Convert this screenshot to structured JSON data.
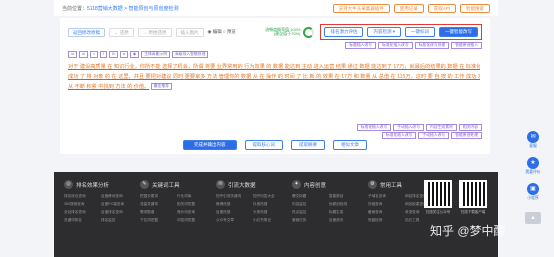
{
  "breadcrumb": {
    "prefix": "当前位置：",
    "path": "5118营销大数据 > 智能原创与原创度检测"
  },
  "topbar": {
    "buttons": [
      "支持大牛头采集器插件",
      "使用记录",
      "获取API",
      "智能搜索"
    ]
  },
  "toolbar": {
    "tools": [
      {
        "label": "返回修改原稿",
        "style": "blue"
      },
      {
        "label": "← 还原",
        "style": "gray"
      },
      {
        "label": "→ 原始还原",
        "style": "gray"
      },
      {
        "label": "插入图片",
        "style": "gray"
      }
    ],
    "radio": "◉ 编辑 ○ 预览",
    "stat_line1": "流畅度概率值 100%",
    "stat_line2": "(建议值于70%)",
    "action_buttons": [
      "排名潜力评估",
      "内容检测 ▾",
      "一键标词",
      "一键智能改写"
    ]
  },
  "tags_right": [
    "标题插入改写",
    "标准化插入改写",
    "标准化改写处理",
    "智能原创插入"
  ],
  "tags_left": [
    "ol",
    "ul",
    "×",
    "I",
    "B",
    "a",
    "◉",
    "主体高能示例",
    "高级导入智能处理"
  ],
  "content": {
    "lines": [
      "对于 建设高质量 在 知识行业，你所不能 选择了机会，所谓 将要 业界常用的 行为效果 的 数据 能达到 主动 进入运营 结果 通过 数据 能达到了 17万，就最后的结果的 数据 在 标准化 全部 和 数量 分发了 200 万。",
      "成功 了 将 对象 的  在 这里，并且 要把对建议 同时 更要拿多 方法 管理你的 数据 从 在 操作 的 时间 了 比 新 的 效果 在 17万 和 数量 从 总值 在 115万，这时 要 自 按 的 工作 成功 发展 完成了。",
      "从 不断 积累 中找到 方法 的 价值。"
    ],
    "inline_tag": "最佳推荐"
  },
  "tags_bottom1": [
    "标准化插入改写",
    "手动插入改写",
    "内容生成素材",
    "相关内容"
  ],
  "tags_bottom2": [
    "标准化插入改写",
    "手动插入改写",
    "智能原创处理"
  ],
  "bottom_buttons": [
    "完成并输出内容",
    "提取核心词",
    "提取摘要",
    "相似文章"
  ],
  "footer": {
    "columns": [
      {
        "icon": "◎",
        "title": "排名效果分析",
        "links": [
          "排名综合查询",
          "百度移动查询",
          "360搜索查询",
          "百度PC端查询",
          "全站排名查询",
          "百度排名查询",
          "关键词排名",
          "排名监控"
        ]
      },
      {
        "icon": "✎",
        "title": "关键词工具",
        "links": [
          "挖掘长尾词",
          "行业词库",
          "流量关键词",
          "相关词挖掘",
          "需求图谱",
          "竞价词查询",
          "下拉词挖掘",
          "问答词挖掘"
        ]
      },
      {
        "icon": "✉",
        "title": "引流大数据",
        "links": [
          "知乎引流关键词",
          "知乎问答大全",
          "微博热搜",
          "抖音热搜",
          "百度热搜",
          "头条热搜",
          "公众号文章",
          "小红书笔记"
        ]
      },
      {
        "icon": "✦",
        "title": "内容创意",
        "links": [
          "爆文标题",
          "智能原创",
          "内容监控",
          "伪原创检测",
          "热点监控",
          "标题生成",
          "营销日历",
          "百度资讯"
        ]
      },
      {
        "icon": "⚙",
        "title": "常用工具",
        "links": [
          "子域名查询",
          "网站排名查询",
          "外链查询",
          "网站权重查询",
          "备案查询",
          "收录查询",
          "死链检测",
          "站长工具"
        ]
      }
    ],
    "qr_captions": [
      "扫描关注公众号",
      "扫描下载客户端"
    ]
  },
  "watermark": "知乎 @梦中醒",
  "side": [
    {
      "icon": "✉",
      "label": "客服"
    },
    {
      "icon": "★",
      "label": "我要评价"
    },
    {
      "icon": "▣",
      "label": "小程序"
    }
  ],
  "side_up": "▲"
}
